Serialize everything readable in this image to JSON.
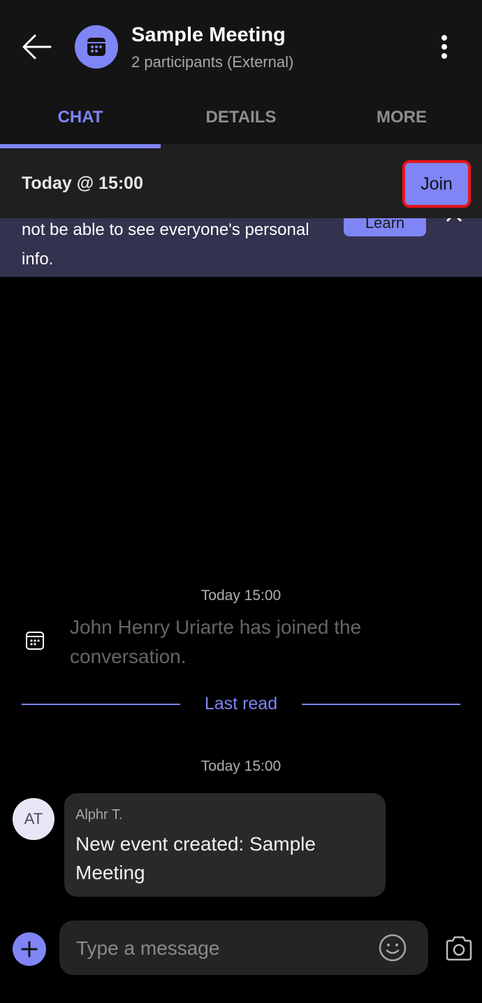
{
  "header": {
    "title": "Sample Meeting",
    "subtitle": "2 participants (External)",
    "back_icon": "arrow-left-icon",
    "avatar_icon": "calendar-icon",
    "more_icon": "more-vertical-icon"
  },
  "tabs": [
    {
      "label": "CHAT",
      "active": true
    },
    {
      "label": "DETAILS",
      "active": false
    },
    {
      "label": "MORE",
      "active": false
    }
  ],
  "meeting_bar": {
    "time": "Today @ 15:00",
    "join_label": "Join"
  },
  "banner": {
    "text": "not be able to see everyone's personal info.",
    "button_label": "Learn",
    "close_icon": "close-icon"
  },
  "conversation": {
    "system_time": "Today 15:00",
    "system_message": "John Henry Uriarte has joined the conversation.",
    "last_read_label": "Last read",
    "message_time": "Today 15:00",
    "message": {
      "avatar_initials": "AT",
      "sender": "Alphr T.",
      "text": "New event created: Sample Meeting"
    }
  },
  "composer": {
    "placeholder": "Type a message",
    "value": ""
  },
  "colors": {
    "accent": "#7f85f5",
    "highlight_border": "#e8141c",
    "banner_bg": "#33334f"
  }
}
